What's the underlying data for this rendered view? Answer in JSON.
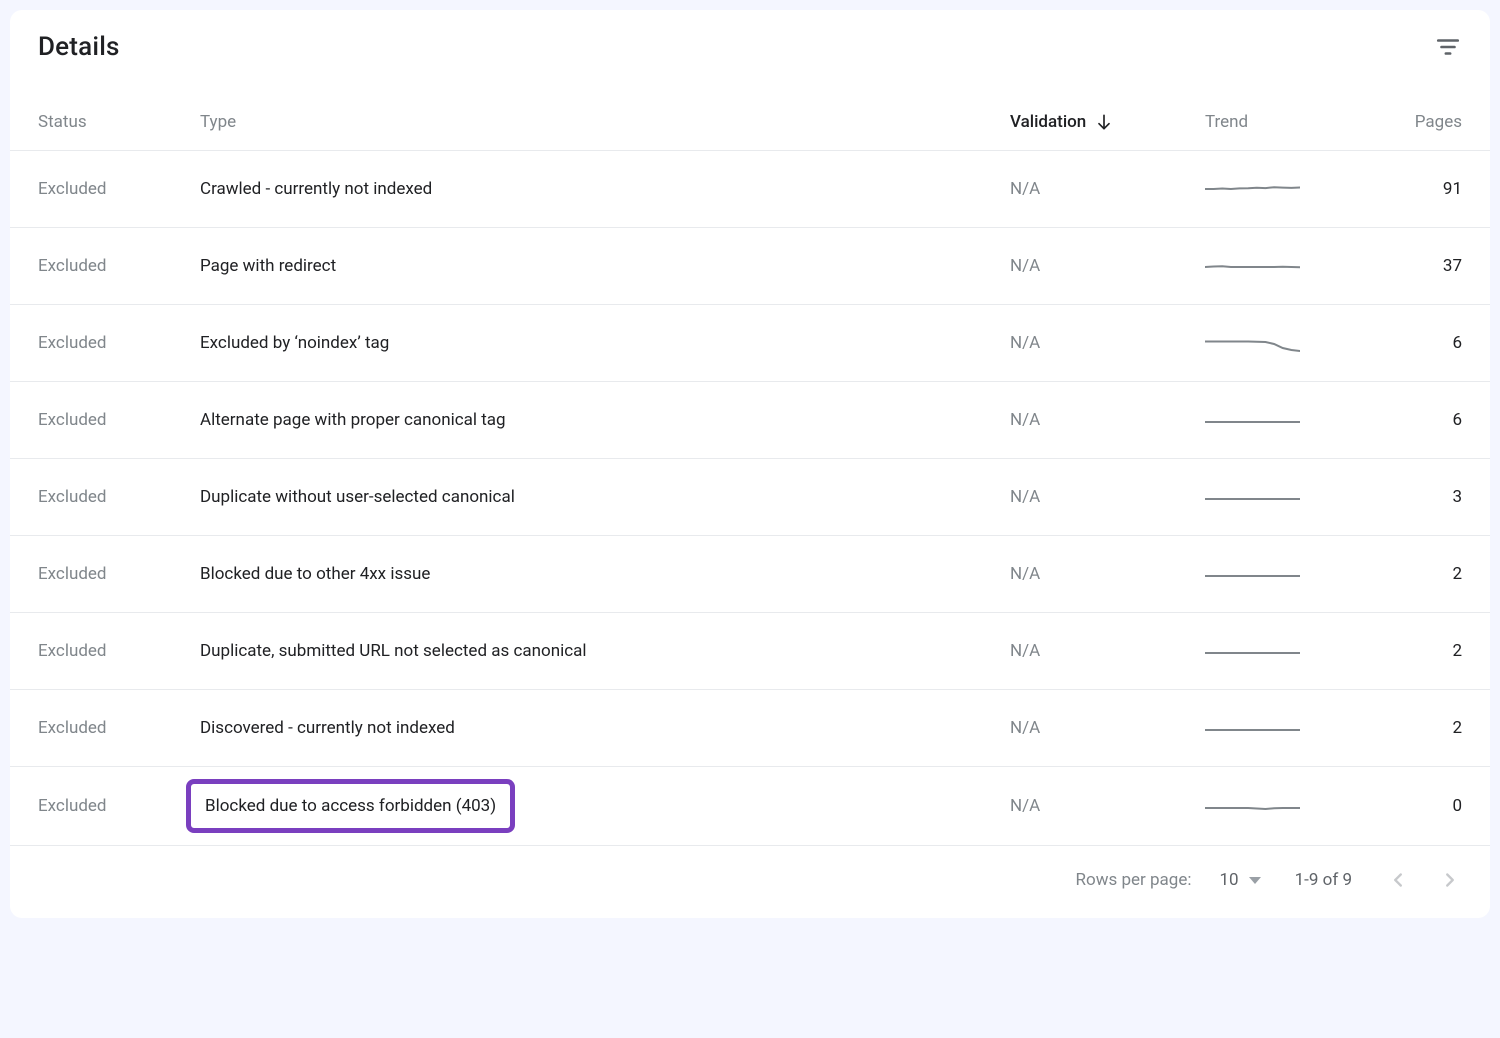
{
  "title": "Details",
  "columns": {
    "status": "Status",
    "type": "Type",
    "validation": "Validation",
    "trend": "Trend",
    "pages": "Pages"
  },
  "rows": [
    {
      "status": "Excluded",
      "type": "Crawled - currently not indexed",
      "validation": "N/A",
      "trend": [
        14,
        14,
        13.5,
        14,
        13.4,
        13.2,
        12.8,
        13.1,
        12.2,
        12.6,
        12.9,
        12.5
      ],
      "pages": "91",
      "highlight": false
    },
    {
      "status": "Excluded",
      "type": "Page with redirect",
      "validation": "N/A",
      "trend": [
        15,
        14.5,
        14.2,
        15,
        15,
        15,
        15,
        15,
        15,
        14.8,
        15,
        15.2
      ],
      "pages": "37",
      "highlight": false
    },
    {
      "status": "Excluded",
      "type": "Excluded by ‘noindex’ tag",
      "validation": "N/A",
      "trend": [
        12.5,
        12.5,
        12.5,
        12.5,
        12.5,
        12.5,
        12.8,
        13,
        15,
        19,
        21,
        22
      ],
      "pages": "6",
      "highlight": false
    },
    {
      "status": "Excluded",
      "type": "Alternate page with proper canonical tag",
      "validation": "N/A",
      "trend": [
        16,
        16,
        16,
        16,
        16,
        16,
        16,
        16,
        16,
        16,
        16,
        16
      ],
      "pages": "6",
      "highlight": false
    },
    {
      "status": "Excluded",
      "type": "Duplicate without user-selected canonical",
      "validation": "N/A",
      "trend": [
        16,
        16,
        16,
        16,
        16,
        16,
        16,
        16,
        16,
        16,
        16,
        16
      ],
      "pages": "3",
      "highlight": false
    },
    {
      "status": "Excluded",
      "type": "Blocked due to other 4xx issue",
      "validation": "N/A",
      "trend": [
        16,
        16,
        16,
        16,
        16,
        16,
        16,
        16,
        16,
        16,
        16,
        16
      ],
      "pages": "2",
      "highlight": false
    },
    {
      "status": "Excluded",
      "type": "Duplicate, submitted URL not selected as canonical",
      "validation": "N/A",
      "trend": [
        16,
        16,
        16,
        16,
        16,
        16,
        16,
        16,
        16,
        16,
        16,
        16
      ],
      "pages": "2",
      "highlight": false
    },
    {
      "status": "Excluded",
      "type": "Discovered - currently not indexed",
      "validation": "N/A",
      "trend": [
        16,
        16,
        16,
        16,
        16,
        16,
        16,
        16,
        16,
        16,
        16,
        16
      ],
      "pages": "2",
      "highlight": false
    },
    {
      "status": "Excluded",
      "type": "Blocked due to access forbidden (403)",
      "validation": "N/A",
      "trend": [
        16,
        16,
        16,
        16,
        16,
        16,
        16.5,
        17,
        16.2,
        16,
        16,
        16
      ],
      "pages": "0",
      "highlight": true
    }
  ],
  "pagination": {
    "rows_per_page_label": "Rows per page:",
    "rows_per_page_value": "10",
    "range": "1-9 of 9"
  },
  "colors": {
    "highlight_border": "#7a3fbf",
    "spark_stroke": "#80868b"
  }
}
